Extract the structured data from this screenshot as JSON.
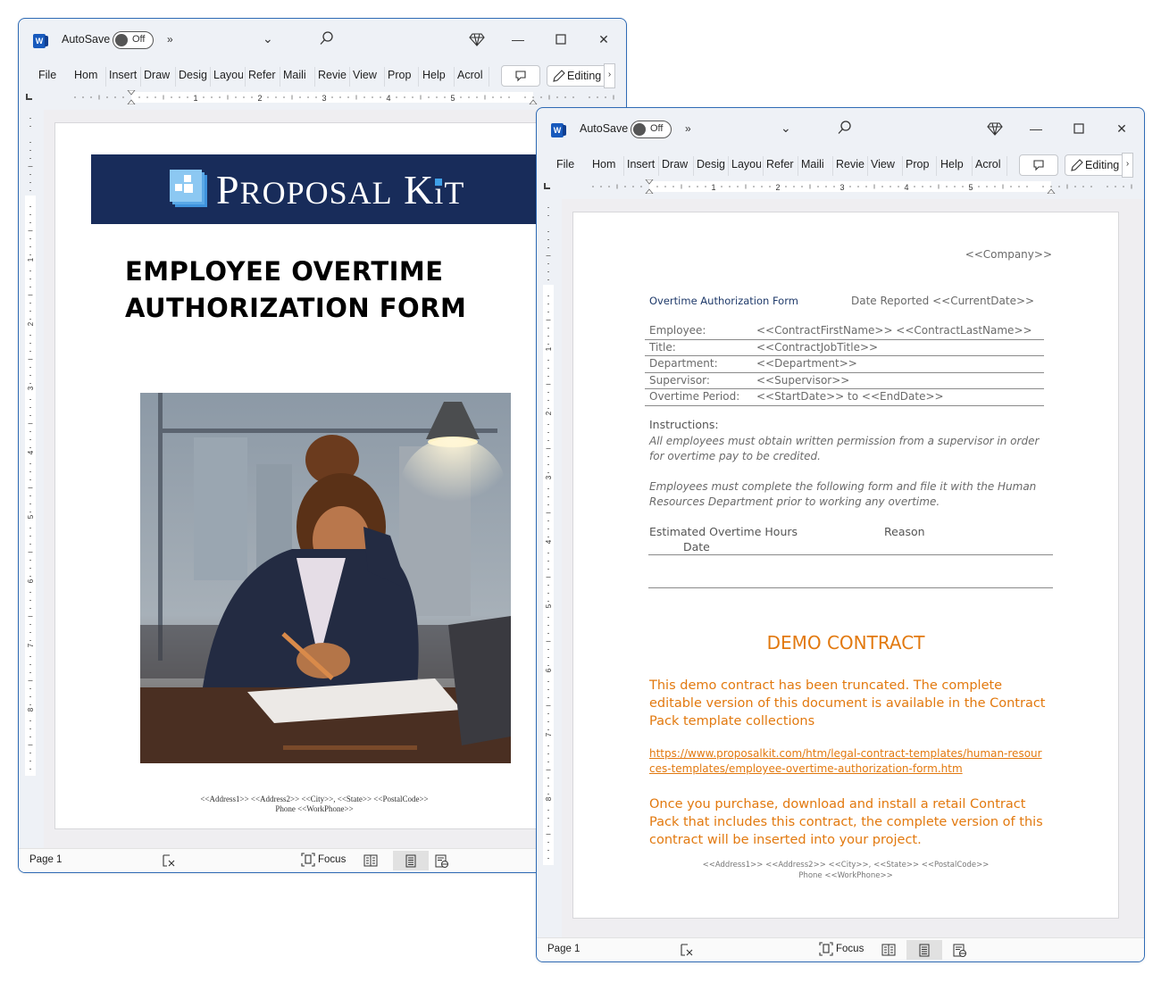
{
  "windows": [
    {
      "id": "cover",
      "titlebar": {
        "app_icon": "word-icon",
        "autosave_label": "AutoSave",
        "autosave_state": "Off",
        "overflow_glyph": "»",
        "dropdown_glyph": "⌄",
        "search_icon": "search-icon",
        "premium_icon": "diamond-icon",
        "minimize_glyph": "—",
        "maximize_glyph": "☐",
        "close_glyph": "✕"
      },
      "ribbon": {
        "tabs": [
          "File",
          "Home",
          "Insert",
          "Draw",
          "Design",
          "Layout",
          "References",
          "Mailings",
          "Review",
          "View",
          "Properties",
          "Help",
          "Acrobat"
        ],
        "tabs_visible": [
          "File",
          "Hom",
          "Insert",
          "Draw",
          "Desig",
          "Layou",
          "Refer",
          "Maili",
          "Revie",
          "View",
          "Prop",
          "Help",
          "Acrol"
        ],
        "comments_icon": "comment-icon",
        "editing_label": "Editing",
        "more_glyph": "›"
      },
      "ruler_numbers": [
        "1",
        "2",
        "3",
        "4",
        "5"
      ],
      "vruler_numbers": [
        "1",
        "2",
        "3",
        "4",
        "5",
        "6",
        "7",
        "8"
      ],
      "page": {
        "brand": {
          "name_big_p": "P",
          "name_rest": "ROPOSAL",
          "name_big_k": "K",
          "name_i": "i",
          "name_t": "T",
          "full": "PROPOSAL KIT",
          "color": "#182c5a"
        },
        "title_line1": "EMPLOYEE OVERTIME",
        "title_line2": "AUTHORIZATION FORM",
        "image_description": "Illustration of a woman in a navy blazer writing on documents at a desk beside a laptop, city window and lamp behind",
        "footer_line1": "<<Address1>> <<Address2>> <<City>>, <<State>> <<PostalCode>>",
        "footer_line2": "Phone <<WorkPhone>>"
      },
      "status": {
        "page_label": "Page 1",
        "proofing_icon": "proofing-icon",
        "focus_label": "Focus",
        "read_mode_icon": "read-mode-icon",
        "print_layout_icon": "print-layout-icon",
        "web_layout_icon": "web-layout-icon"
      }
    },
    {
      "id": "form",
      "titlebar": {
        "app_icon": "word-icon",
        "autosave_label": "AutoSave",
        "autosave_state": "Off",
        "overflow_glyph": "»",
        "dropdown_glyph": "⌄",
        "search_icon": "search-icon",
        "premium_icon": "diamond-icon",
        "minimize_glyph": "—",
        "maximize_glyph": "☐",
        "close_glyph": "✕"
      },
      "ribbon": {
        "tabs_visible": [
          "File",
          "Hom",
          "Insert",
          "Draw",
          "Desig",
          "Layou",
          "Refer",
          "Maili",
          "Revie",
          "View",
          "Prop",
          "Help",
          "Acrol"
        ],
        "comments_icon": "comment-icon",
        "editing_label": "Editing",
        "more_glyph": "›"
      },
      "ruler_numbers": [
        "1",
        "2",
        "3",
        "4",
        "5"
      ],
      "vruler_numbers": [
        "1",
        "2",
        "3",
        "4",
        "5",
        "6",
        "7",
        "8"
      ],
      "page": {
        "company": "<<Company>>",
        "form_title": "Overtime Authorization Form",
        "date_reported": "Date Reported <<CurrentDate>>",
        "fields": [
          {
            "label": "Employee:",
            "value": "<<ContractFirstName>> <<ContractLastName>>"
          },
          {
            "label": "Title:",
            "value": "<<ContractJobTitle>>"
          },
          {
            "label": "Department:",
            "value": "<<Department>>"
          },
          {
            "label": "Supervisor:",
            "value": "<<Supervisor>>"
          },
          {
            "label": "Overtime Period:",
            "value": "<<StartDate>> to <<EndDate>>"
          }
        ],
        "instructions_heading": "Instructions:",
        "instructions_1": "All employees must obtain written permission from a supervisor in order for overtime pay to be credited.",
        "instructions_2": "Employees must complete the following form and file it with the Human Resources Department prior to working any overtime.",
        "col_estimated": "Estimated Overtime Hours",
        "col_reason": "Reason",
        "col_date": "Date",
        "demo_title": "DEMO CONTRACT",
        "demo_para1": "This demo contract has been truncated. The complete editable version of this document is available in the Contract Pack template collections",
        "demo_link": "https://www.proposalkit.com/htm/legal-contract-templates/human-resources-templates/employee-overtime-authorization-form.htm",
        "demo_para2": "Once you purchase, download and install a retail Contract Pack that includes this contract, the complete version of this contract will be inserted into your project.",
        "footer_line1": "<<Address1>> <<Address2>> <<City>>, <<State>> <<PostalCode>>",
        "footer_line2": "Phone <<WorkPhone>>",
        "accent_color": "#e2790f",
        "title_color": "#1f3a6a"
      },
      "status": {
        "page_label": "Page 1",
        "proofing_icon": "proofing-icon",
        "focus_label": "Focus",
        "read_mode_icon": "read-mode-icon",
        "print_layout_icon": "print-layout-icon",
        "web_layout_icon": "web-layout-icon"
      }
    }
  ]
}
